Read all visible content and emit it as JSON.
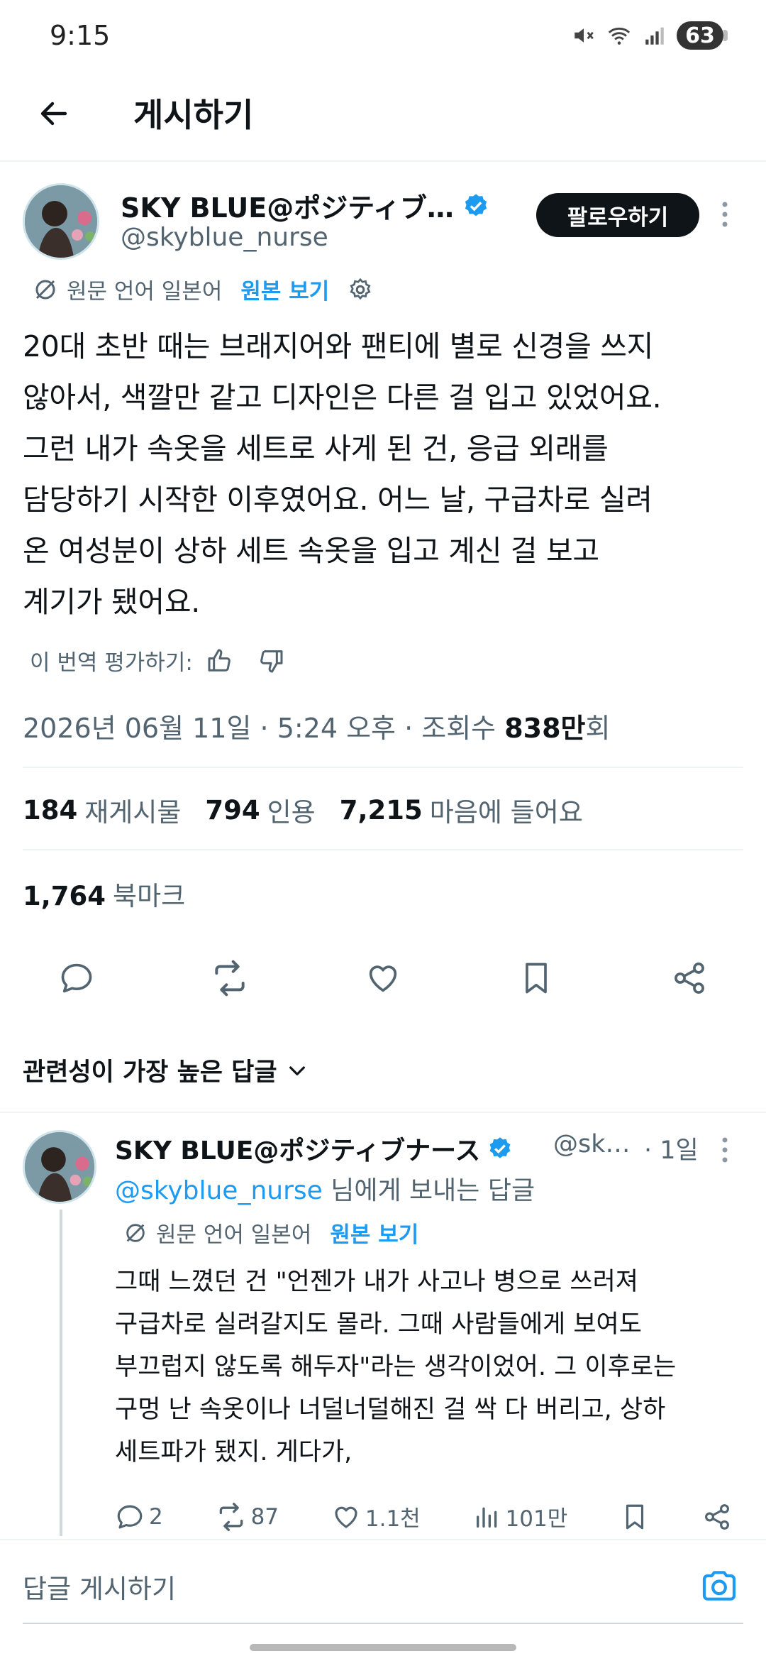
{
  "status": {
    "time": "9:15",
    "battery": "63"
  },
  "header": {
    "title": "게시하기"
  },
  "post": {
    "author_name": "SKY BLUE@ポジティブ…",
    "handle": "@skyblue_nurse",
    "follow_label": "팔로우하기",
    "translate_note": "원문 언어 일본어",
    "view_original": "원본 보기",
    "body_lines": [
      "20대 초반 때는 브래지어와 팬티에 별로 신경을 쓰지",
      "않아서, 색깔만 같고 디자인은 다른 걸 입고 있었어요.",
      "그런 내가 속옷을 세트로 사게 된 건, 응급 외래를",
      "담당하기 시작한 이후였어요. 어느 날, 구급차로 실려",
      "온 여성분이 상하 세트 속옷을 입고 계신 걸 보고",
      "계기가 됐어요."
    ],
    "rate_label": "이 번역 평가하기:",
    "meta_time": "2026년 06월 11일 · 5:24 오후 · 조회수 ",
    "meta_views": "838만",
    "meta_suffix": "회",
    "stats": {
      "reposts": "184",
      "reposts_label": "재게시물",
      "quotes": "794",
      "quotes_label": "인용",
      "likes": "7,215",
      "likes_label": "마음에 들어요",
      "bookmarks": "1,764",
      "bookmarks_label": "북마크"
    }
  },
  "sort_label": "관련성이 가장 높은 답글",
  "reply": {
    "author_name": "SKY BLUE@ポジティブナース",
    "handle": "@sk…",
    "time": "· 1일",
    "reply_to_handle": "@skyblue_nurse",
    "reply_to_suffix": " 님에게 보내는 답글",
    "translate_note": "원문 언어 일본어",
    "view_original": "원본 보기",
    "body_lines": [
      "그때 느꼈던 건 \"언젠가 내가 사고나 병으로 쓰러져",
      "구급차로 실려갈지도 몰라. 그때 사람들에게 보여도",
      "부끄럽지 않도록 해두자\"라는 생각이었어. 그 이후로는",
      "구멍 난 속옷이나 너덜너덜해진 걸 싹 다 버리고, 상하",
      "세트파가 됐지. 게다가,"
    ],
    "replies": "2",
    "reposts": "87",
    "likes": "1.1천",
    "views": "101만"
  },
  "composer": {
    "placeholder": "답글 게시하기"
  },
  "colors": {
    "accent": "#1d9bf0",
    "text": "#0f1419",
    "muted": "#536471"
  }
}
